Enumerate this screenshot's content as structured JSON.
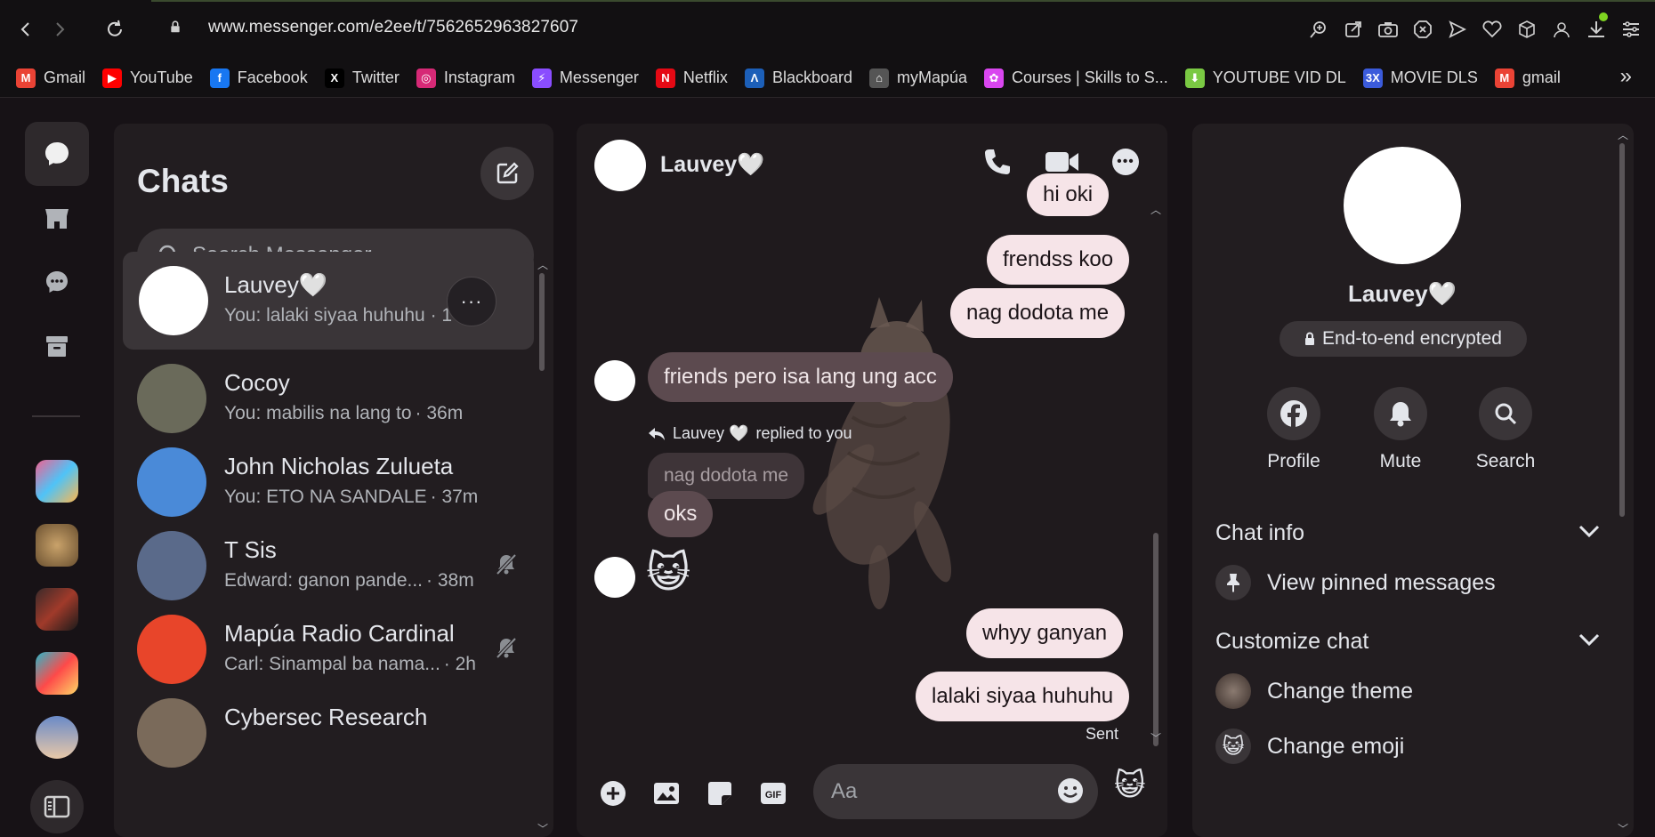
{
  "browser": {
    "url": "www.messenger.com/e2ee/t/7562652963827607",
    "bookmarks": [
      {
        "label": "Gmail",
        "color": "#ea4335",
        "glyph": "M"
      },
      {
        "label": "YouTube",
        "color": "#ff0000",
        "glyph": "▶"
      },
      {
        "label": "Facebook",
        "color": "#1877f2",
        "glyph": "f"
      },
      {
        "label": "Twitter",
        "color": "#000000",
        "glyph": "X"
      },
      {
        "label": "Instagram",
        "color": "#d62976",
        "glyph": "◎"
      },
      {
        "label": "Messenger",
        "color": "#8a4dff",
        "glyph": "⚡"
      },
      {
        "label": "Netflix",
        "color": "#e50914",
        "glyph": "N"
      },
      {
        "label": "Blackboard",
        "color": "#1c5fb8",
        "glyph": "Λ"
      },
      {
        "label": "myMapúa",
        "color": "#555555",
        "glyph": "⌂"
      },
      {
        "label": "Courses | Skills to S...",
        "color": "#d946ef",
        "glyph": "✿"
      },
      {
        "label": "YOUTUBE VID DL",
        "color": "#7ac943",
        "glyph": "⬇"
      },
      {
        "label": "MOVIE DLS",
        "color": "#3b5bdb",
        "glyph": "3X"
      },
      {
        "label": "gmail",
        "color": "#ea4335",
        "glyph": "M"
      }
    ],
    "more": "»"
  },
  "chats": {
    "title": "Chats",
    "search_placeholder": "Search Messenger",
    "list": [
      {
        "name": "Lauvey🤍",
        "preview": "You: lalaki siyaa huhuhu · 1",
        "time": "",
        "muted": false,
        "selected": true,
        "avatar_color": "#ffffff"
      },
      {
        "name": "Cocoy",
        "preview": "You: mabilis na lang to",
        "time": "· 36m",
        "muted": false,
        "selected": false,
        "avatar_color": "#6a6a5a"
      },
      {
        "name": "John Nicholas Zulueta",
        "preview": "You: ETO NA SANDALE",
        "time": "· 37m",
        "muted": false,
        "selected": false,
        "avatar_color": "#4a8ad8"
      },
      {
        "name": "T Sis",
        "preview": "Edward: ganon pande...",
        "time": "· 38m",
        "muted": true,
        "selected": false,
        "avatar_color": "#5a6a8a"
      },
      {
        "name": "Mapúa Radio Cardinal",
        "preview": "Carl: Sinampal ba nama...",
        "time": "· 2h",
        "muted": true,
        "selected": false,
        "avatar_color": "#e8452a"
      },
      {
        "name": "Cybersec Research",
        "preview": "",
        "time": "",
        "muted": false,
        "selected": false,
        "avatar_color": "#7a6a5a"
      }
    ]
  },
  "conversation": {
    "contact_name": "Lauvey🤍",
    "messages": [
      {
        "text": "hi oki",
        "from": "me"
      },
      {
        "text": "frendss koo",
        "from": "me"
      },
      {
        "text": "nag dodota me",
        "from": "me"
      },
      {
        "text": "friends pero isa lang ung acc",
        "from": "them"
      },
      {
        "reply_label_name": "Lauvey 🤍",
        "reply_label_suffix": "replied to you",
        "quoted": "nag dodota me"
      },
      {
        "text": "oks",
        "from": "them"
      },
      {
        "text": "😺",
        "from": "them",
        "emoji": true
      },
      {
        "text": "whyy ganyan",
        "from": "me"
      },
      {
        "text": "lalaki siyaa huhuhu",
        "from": "me"
      }
    ],
    "status": "Sent",
    "composer_placeholder": "Aa",
    "quick_emoji": "😺"
  },
  "info": {
    "name": "Lauvey🤍",
    "encryption": "End-to-end encrypted",
    "actions": [
      {
        "label": "Profile",
        "icon": "facebook-icon"
      },
      {
        "label": "Mute",
        "icon": "bell-icon"
      },
      {
        "label": "Search",
        "icon": "search-icon"
      }
    ],
    "sections": {
      "chat_info": "Chat info",
      "pinned": "View pinned messages",
      "customize": "Customize chat",
      "theme": "Change theme",
      "emoji": "Change emoji",
      "emoji_glyph": "😺"
    }
  }
}
